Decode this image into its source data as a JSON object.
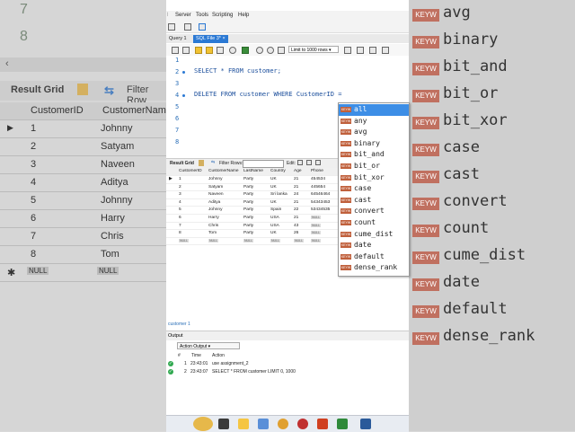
{
  "background_left": {
    "line_numbers": [
      "7",
      "8"
    ],
    "grid_label": "Result Grid",
    "filter_label": "Filter Row",
    "columns": [
      "CustomerID",
      "CustomerNam"
    ],
    "rows": [
      {
        "id": "1",
        "name": "Johnny"
      },
      {
        "id": "2",
        "name": "Satyam"
      },
      {
        "id": "3",
        "name": "Naveen"
      },
      {
        "id": "4",
        "name": "Aditya"
      },
      {
        "id": "5",
        "name": "Johnny"
      },
      {
        "id": "6",
        "name": "Harry"
      },
      {
        "id": "7",
        "name": "Chris"
      },
      {
        "id": "8",
        "name": "Tom"
      },
      {
        "id": "NULL",
        "name": "NULL"
      }
    ]
  },
  "background_right": {
    "badge": "KEYW",
    "keywords": [
      "avg",
      "binary",
      "bit_and",
      "bit_or",
      "bit_xor",
      "case",
      "cast",
      "convert",
      "count",
      "cume_dist",
      "date",
      "default",
      "dense_rank"
    ]
  },
  "menu": {
    "items": [
      "Server",
      "Tools",
      "Scripting",
      "Help"
    ]
  },
  "tabs": [
    {
      "label": "Query 1",
      "active": false
    },
    {
      "label": "SQL File 3*",
      "active": true
    }
  ],
  "editor_toolbar": {
    "limit": "Limit to 1000 rows"
  },
  "editor": {
    "line_numbers": [
      "1",
      "2",
      "3",
      "4",
      "5",
      "6",
      "7",
      "8"
    ],
    "line2": {
      "keyword1": "SELECT",
      "star": "*",
      "keyword2": "FROM",
      "rest": "customer;"
    },
    "line4": {
      "keyword1": "DELETE FROM",
      "table": "customer",
      "keyword2": "WHERE",
      "column": "CustomerID",
      "op": "="
    }
  },
  "autocomplete": {
    "badge": "KEYW",
    "items": [
      "all",
      "any",
      "avg",
      "binary",
      "bit_and",
      "bit_or",
      "bit_xor",
      "case",
      "cast",
      "convert",
      "count",
      "cume_dist",
      "date",
      "default",
      "dense_rank"
    ],
    "selected_index": 0
  },
  "result": {
    "grid_label": "Result Grid",
    "filter_label": "Filter Rows:",
    "edit_label": "Edit:",
    "columns": [
      "CustomerID",
      "CustomerName",
      "LastName",
      "Country",
      "Age",
      "Phone"
    ],
    "rows": [
      [
        "1",
        "Johnny",
        "Party",
        "UK",
        "21",
        "454534"
      ],
      [
        "2",
        "Satyam",
        "Party",
        "UK",
        "21",
        "445654"
      ],
      [
        "3",
        "Naveen",
        "Party",
        "Sri lanka",
        "24",
        "64546464"
      ],
      [
        "4",
        "Aditya",
        "Party",
        "UK",
        "21",
        "54343453"
      ],
      [
        "5",
        "Johnny",
        "Party",
        "Spain",
        "22",
        "53434535"
      ],
      [
        "6",
        "Harry",
        "Party",
        "USA",
        "21",
        "NULL"
      ],
      [
        "7",
        "Chris",
        "Party",
        "USA",
        "43",
        "NULL"
      ],
      [
        "8",
        "Tom",
        "Party",
        "UK",
        "26",
        "NULL"
      ],
      [
        "NULL",
        "NULL",
        "NULL",
        "NULL",
        "NULL",
        "NULL"
      ]
    ],
    "result_tab": "customer 1"
  },
  "output": {
    "title": "Output",
    "mode": "Action Output",
    "columns": [
      "#",
      "Time",
      "Action"
    ],
    "rows": [
      {
        "num": "1",
        "time": "23:43:01",
        "action": "use assignment_2"
      },
      {
        "num": "2",
        "time": "23:43:07",
        "action": "SELECT * FROM customer LIMIT 0, 1000"
      }
    ]
  },
  "colors": {
    "accent": "#2b79d4",
    "keyword_badge": "#c0603c",
    "success": "#2fa84f"
  }
}
